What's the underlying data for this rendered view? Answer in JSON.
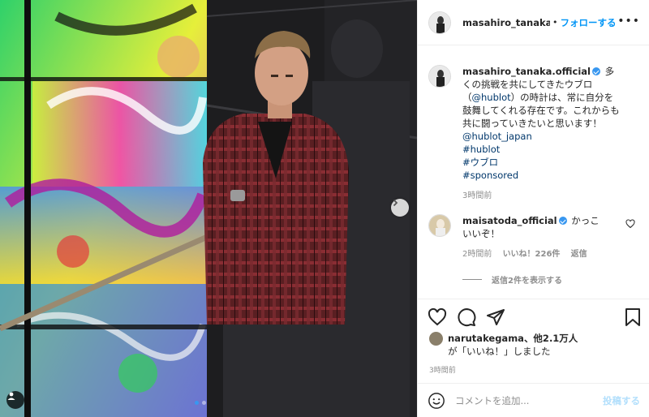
{
  "header": {
    "username": "masahiro_tanaka.o",
    "separator": "•",
    "follow_label": "フォローする",
    "more_label": "•••"
  },
  "caption": {
    "username": "masahiro_tanaka.official",
    "text": "多くの挑戦を共にしてきたウブロ（",
    "mention_inline": "@hublot",
    "text2": "）の時計は、常に自分を鼓舞してくれる存在です。これからも共に闘っていきたいと思います！",
    "mention": "@hublot_japan",
    "hashtags": [
      "#hublot",
      "#ウブロ",
      "#sponsored"
    ],
    "time": "3時間前"
  },
  "reply": {
    "username": "maisatoda_official",
    "text": "かっこいいぞ！",
    "time": "2時間前",
    "likes": "いいね！226件",
    "reply_label": "返信",
    "view_replies": "返信2件を表示する"
  },
  "likes": {
    "user": "narutakegama",
    "text": "、他2.1万人",
    "line2": "が「いいね！」しました"
  },
  "post_time": "3時間前",
  "add_comment": {
    "placeholder": "コメントを追加...",
    "post_label": "投稿する"
  },
  "colors": {
    "link_blue": "#0095f6",
    "verified": "#3897f0",
    "muted": "#8e8e8e",
    "post_disabled": "#b2dffc"
  },
  "icons": [
    "tag-user-icon",
    "chevron-right-icon",
    "heart-icon",
    "comment-icon",
    "share-icon",
    "bookmark-icon",
    "emoji-icon",
    "verified-icon"
  ]
}
